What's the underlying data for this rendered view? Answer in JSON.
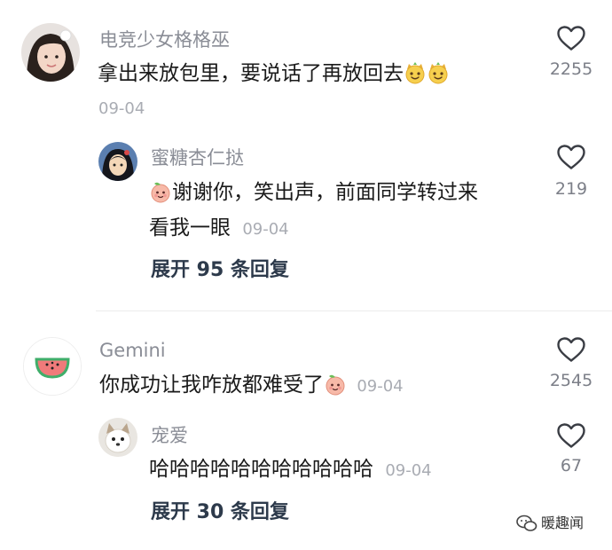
{
  "comments": [
    {
      "user": "电竞少女格格巫",
      "text": "拿出来放包里，要说话了再放回去",
      "date": "09-04",
      "likes": "2255",
      "emoji": [
        "cat-smile-emoji",
        "cat-smile-emoji"
      ],
      "reply": {
        "user": "蜜糖杏仁挞",
        "text_line1": "谢谢你，笑出声，前面同学转过来",
        "text_line2": "看我一眼",
        "date": "09-04",
        "likes": "219"
      },
      "expand": "展开 95 条回复"
    },
    {
      "user": "Gemini",
      "text": "你成功让我咋放都难受了",
      "date": "09-04",
      "likes": "2545",
      "reply": {
        "user": "宠爱",
        "text": "哈哈哈哈哈哈哈哈哈哈哈",
        "date": "09-04",
        "likes": "67"
      },
      "expand": "展开 30 条回复"
    }
  ],
  "watermark": "暖趣闻",
  "colors": {
    "username": "#8a8d96",
    "text": "#1a1a1a",
    "meta": "#a9acb3",
    "expand": "#2d3a4b",
    "watermelon": "#f07a7a"
  }
}
